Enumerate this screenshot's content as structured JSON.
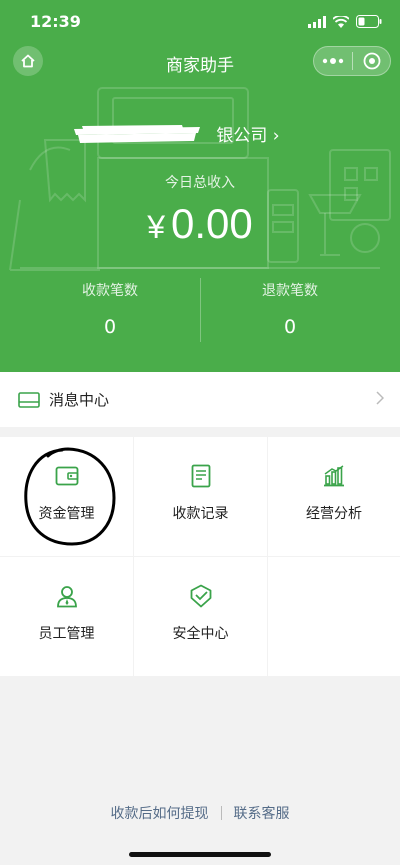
{
  "status_bar": {
    "time": "12:39"
  },
  "nav": {
    "title": "商家助手"
  },
  "merchant": {
    "company_suffix": "银公司 ›"
  },
  "today": {
    "label": "今日总收入",
    "currency": "¥",
    "amount": "0.00"
  },
  "stats": [
    {
      "label": "收款笔数",
      "value": "0"
    },
    {
      "label": "退款笔数",
      "value": "0"
    }
  ],
  "message_center": {
    "label": "消息中心"
  },
  "menu": [
    {
      "label": "资金管理",
      "icon": "wallet-icon"
    },
    {
      "label": "收款记录",
      "icon": "receipt-icon"
    },
    {
      "label": "经营分析",
      "icon": "bar-chart-icon"
    },
    {
      "label": "员工管理",
      "icon": "staff-icon"
    },
    {
      "label": "安全中心",
      "icon": "shield-icon"
    }
  ],
  "footer": {
    "how_to_withdraw": "收款后如何提现",
    "contact_support": "联系客服"
  },
  "colors": {
    "brand_green": "#4aad4a",
    "icon_green": "#3aa34a",
    "link_blue": "#556c88"
  }
}
